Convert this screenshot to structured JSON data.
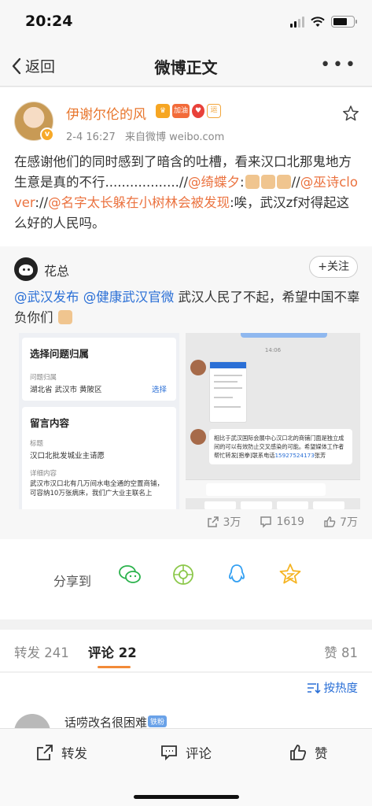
{
  "status_bar": {
    "time": "20:24"
  },
  "nav": {
    "back_label": "返回",
    "title": "微博正文"
  },
  "post": {
    "username": "伊谢尔伦的风",
    "badge_vip": "加油",
    "badge_yun": "运",
    "time": "2-4 16:27",
    "source": "来自微博 weibo.com",
    "text_1": "在感谢他们的同时感到了暗含的吐槽，看来汉口北那鬼地方生意是真的不行..................//",
    "mention_1": "@绮蝶夕",
    "text_2": ":",
    "text_3": "//",
    "mention_2": "@巫诗clover",
    "text_4": "://",
    "mention_3": "@名字太长躲在小树林会被发现",
    "text_5": ":唉，武汉zf对得起这么好的人民吗。"
  },
  "repost": {
    "author": "花总",
    "follow_label": "+关注",
    "mention_1": "@武汉发布",
    "mention_2": "@健康武汉官微",
    "text": " 武汉人民了不起，希望中国不辜负你们 ",
    "image_left": {
      "card1_title": "选择问题归属",
      "card1_field_label": "问题归属",
      "card1_field_value": "湖北省 武汉市 黄陂区",
      "card1_button": "选择",
      "card2_title": "留言内容",
      "card2_label_title": "标题",
      "card2_value_title": "汉口北批发城业主请愿",
      "card2_label_detail": "详细内容",
      "card2_detail_text": "武汉市汉口北有几万间水电全通的空置商铺，可容纳10万张病床，我们广大业主联名上"
    },
    "image_right": {
      "chat_time": "14:06",
      "message": "相比于武汉国际会展中心汉口北的商铺门面是独立成间的可以有效防止交叉感染的可能。希望媒体工作者帮忙转发[抱拳]联系电话",
      "phone": "15927524173",
      "signature": "张芳"
    },
    "stats": {
      "reposts": "3万",
      "comments": "1619",
      "likes": "7万"
    }
  },
  "share": {
    "label": "分享到"
  },
  "tabs": {
    "repost_label": "转发",
    "repost_count": "241",
    "comment_label": "评论",
    "comment_count": "22",
    "like_label": "赞",
    "like_count": "81"
  },
  "sort": {
    "label": "按热度"
  },
  "comment": {
    "name": "话唠改名很困难",
    "badge": "铁粉"
  },
  "bottom_bar": {
    "repost": "转发",
    "comment": "评论",
    "like": "赞"
  },
  "colors": {
    "accent_orange": "#eb7340",
    "link_blue": "#2a6fd6",
    "tab_underline": "#f28a38"
  },
  "icons": [
    "back-chevron-icon",
    "more-icon",
    "star-icon",
    "repost-icon",
    "comment-icon",
    "like-icon",
    "wechat-icon",
    "moments-icon",
    "qq-icon",
    "qzone-icon",
    "sort-icon"
  ]
}
